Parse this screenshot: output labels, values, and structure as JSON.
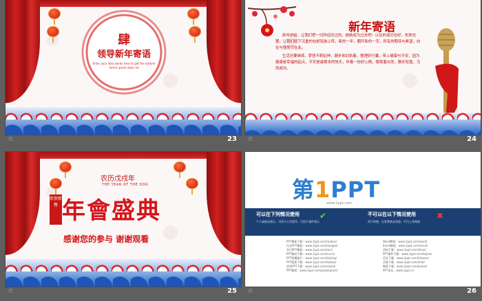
{
  "slides": [
    {
      "number": "23",
      "star": "☆",
      "medal_title": "肆",
      "medal_subtitle": "领导新年寄语",
      "medal_small": "Enter your idea words here to get the bottom lorem ipsum dolor sit"
    },
    {
      "number": "24",
      "star": "☆",
      "title": "新年寄语",
      "paragraphs": [
        "新年伊始，让我们把一切所经历过的，统统成为过去吧！以往的成功也好，失败也罢，让我们卸下沉重的包袱轻装上阵，新的一年，翻开新的一页，所有的期待与希望，向往与憧憬尽在此。",
        "生活还要继续，梦想不断延伸，脚步依旧执着。整理好行囊，带上健康与平安，因为健康是幸福的起点，平安是最根本的快乐，伴着一份好心情，微笑着出发，脚步轻盈，马到成功。"
      ]
    },
    {
      "number": "25",
      "star": "☆",
      "sub1": "农历戊戌年",
      "sub2": "THE YEAR OF THE DOG",
      "seal": "恭贺新春",
      "big": "年會盛典",
      "thanks": "感谢您的参与 谢谢观看"
    },
    {
      "number": "26",
      "star": "☆",
      "logo_main": "第",
      "logo_one": "1",
      "logo_rest": "PPT",
      "url": "www.1ppt.com",
      "allowed_title": "可以在下列情况使用",
      "allowed_desc": "个人或商业演示，可用于公司宣传，可用于课件演示",
      "forbidden_title": "不可以在以下情况使用",
      "forbidden_desc": "用于转售、分发等商业用途，不可上传网络",
      "links_left": [
        "PPT模板下载：www.1ppt.com/moban/",
        "行业PPT模板：www.1ppt.com/hangye/",
        "节日PPT模板：www.1ppt.com/jieri/",
        "PPT素材下载：www.1ppt.com/sucai/",
        "PPT背景图片：www.1ppt.com/beijing/",
        "PPT图表下载：www.1ppt.com/tubiao/",
        "优秀PPT下载：www.1ppt.com/xiazai/",
        "PPT教程：www.1ppt.com/powerpoint/"
      ],
      "links_right": [
        "Word教程：www.1ppt.com/word/",
        "Excel教程：www.1ppt.com/excel/",
        "资料下载：www.1ppt.com/ziliao/",
        "PPT课件下载：www.1ppt.com/kejian/",
        "范文下载：www.1ppt.com/fanwen/",
        "试卷下载：www.1ppt.com/shiti/",
        "教案下载：www.1ppt.com/jiaoan/",
        "PPT论坛：www.1ppt.cn"
      ]
    }
  ],
  "colors": {
    "red": "#c91a1a",
    "blue": "#2d7fd1",
    "navy": "#1c3f73",
    "background": "#5f5f5f"
  }
}
